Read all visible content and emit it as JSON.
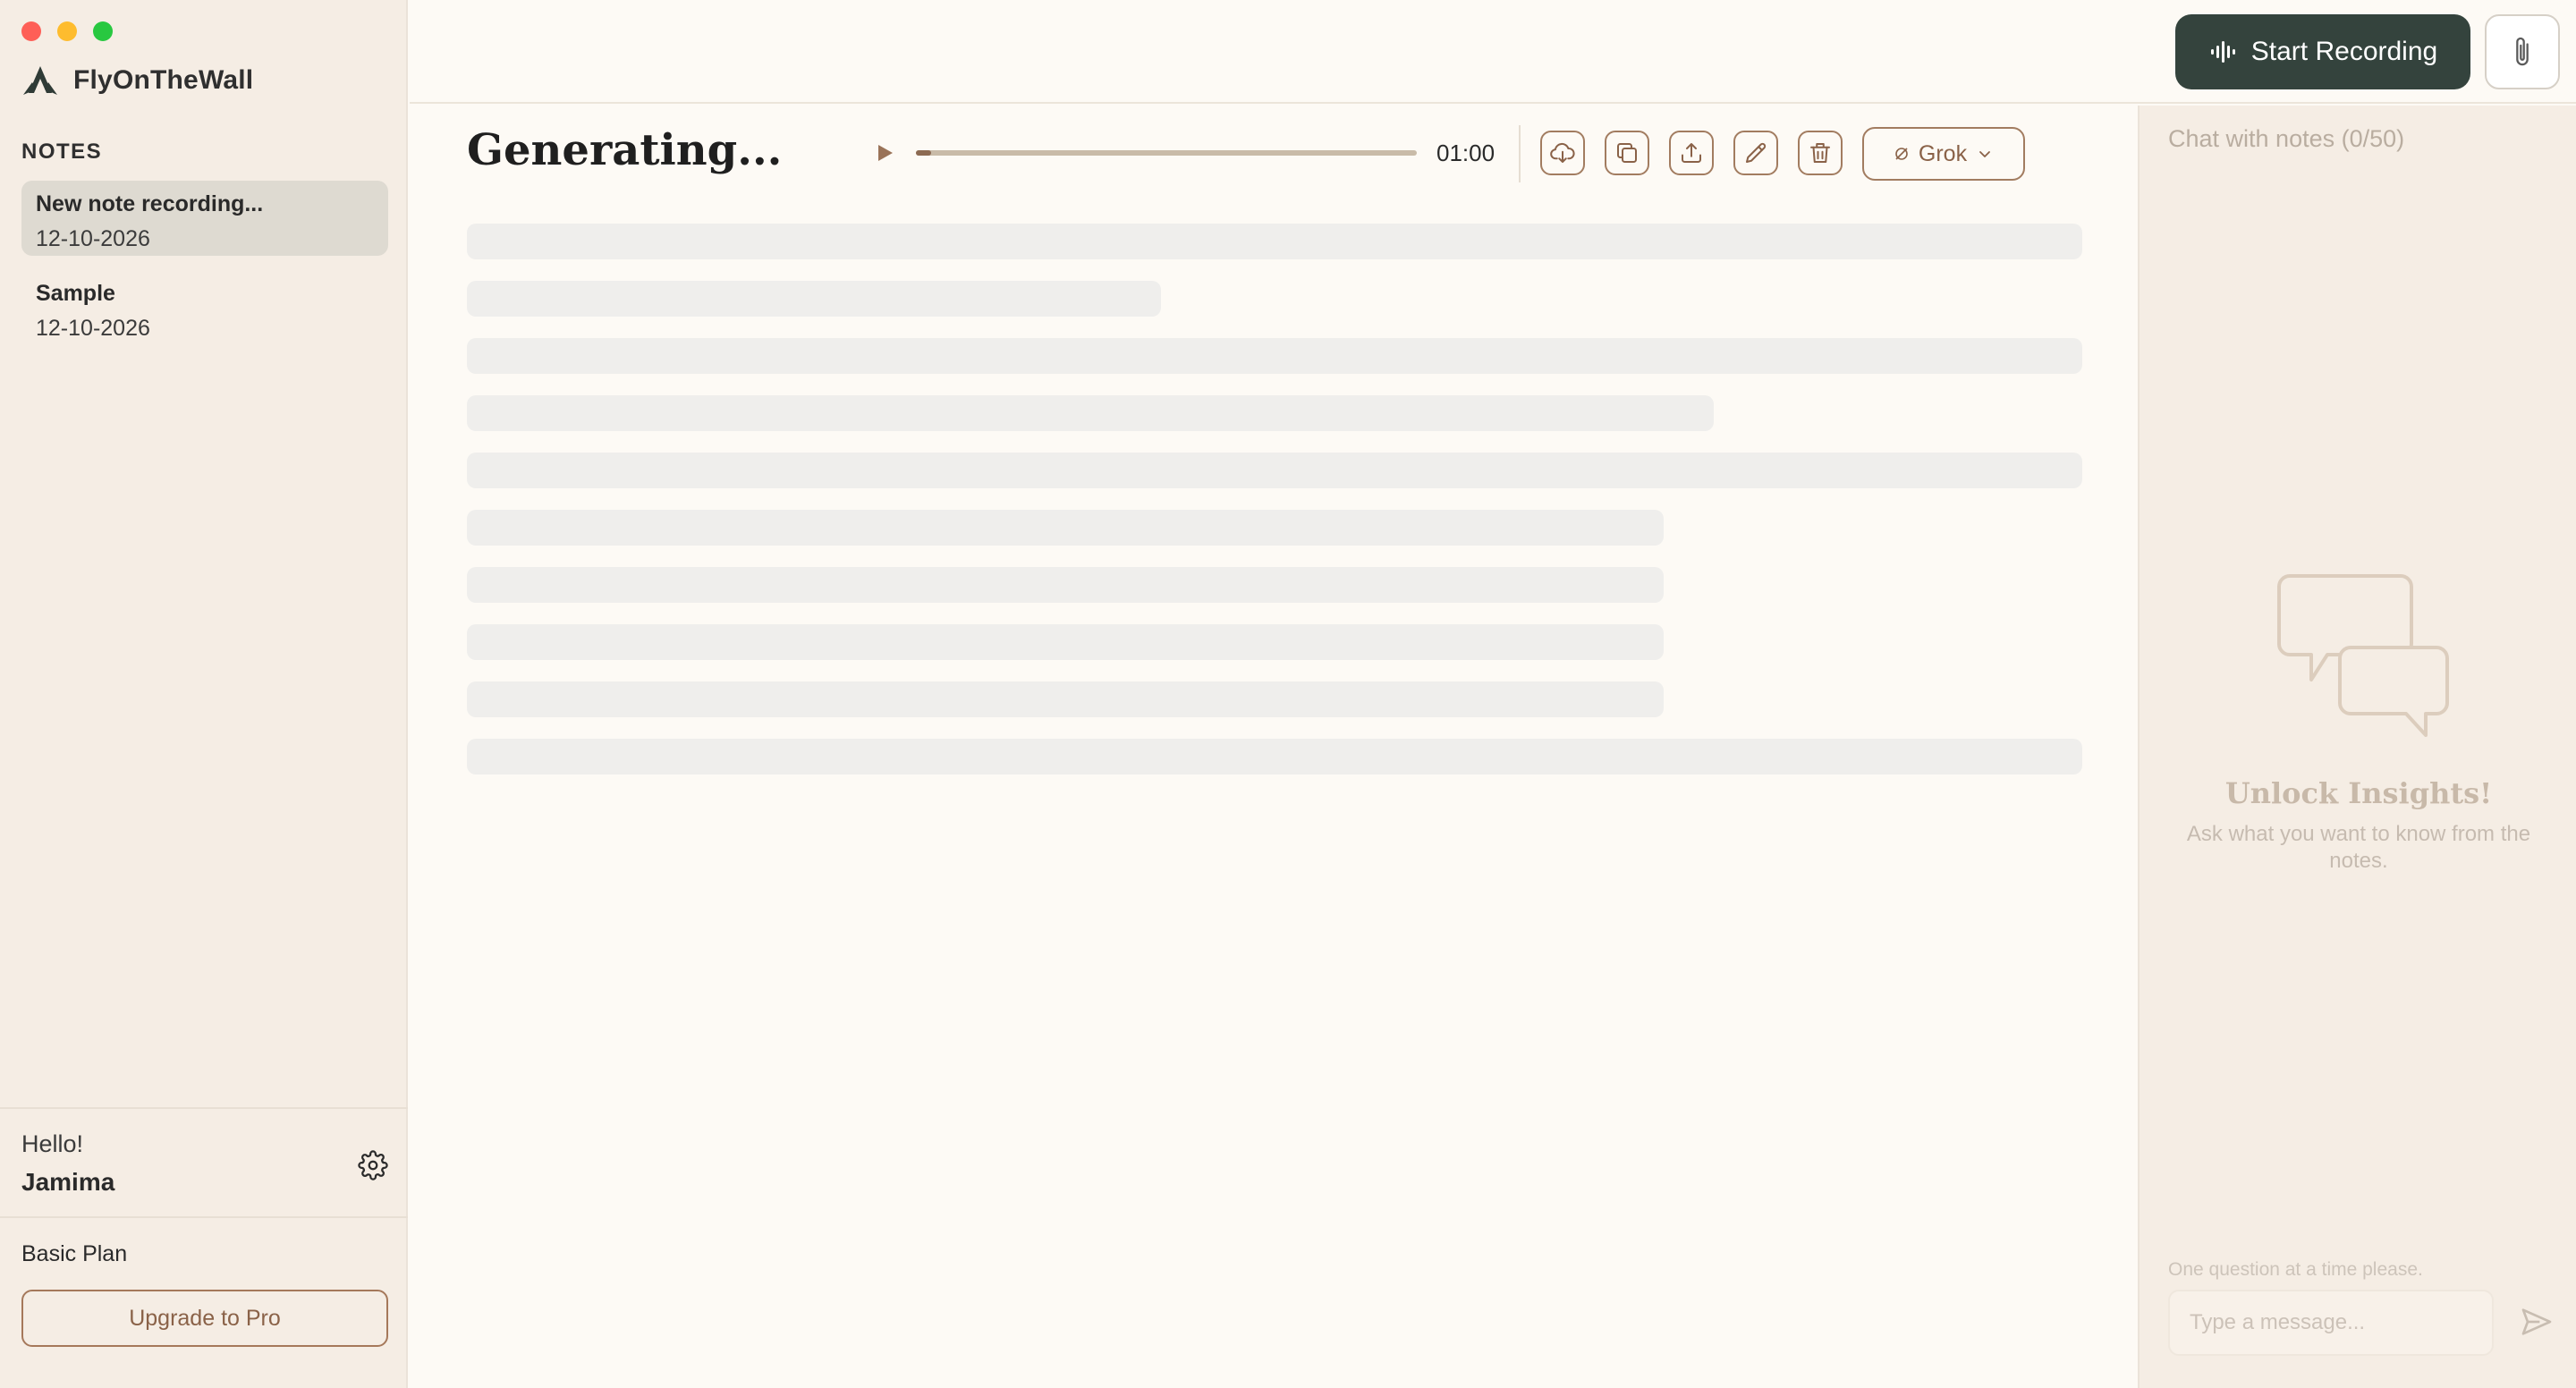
{
  "app": {
    "name": "FlyOnTheWall"
  },
  "sidebar": {
    "notes_heading": "NOTES",
    "notes": [
      {
        "title": "New note recording...",
        "date": "12-10-2026",
        "active": true
      },
      {
        "title": "Sample",
        "date": "12-10-2026",
        "active": false
      }
    ],
    "greeting": "Hello!",
    "user_name": "Jamima",
    "plan": "Basic Plan",
    "upgrade_label": "Upgrade to Pro"
  },
  "header": {
    "record_label": "Start Recording"
  },
  "note_view": {
    "title": "Generating...",
    "duration": "01:00",
    "progress_fraction": 0.03,
    "model": "Grok",
    "tools": [
      "download-icon",
      "copy-icon",
      "export-icon",
      "edit-icon",
      "delete-icon"
    ],
    "loading_lines": 10
  },
  "chat": {
    "title": "Chat with notes",
    "count": "(0/50)",
    "empty_title": "Unlock Insights!",
    "empty_subtitle": "Ask what you want to know from the notes.",
    "hint": "One question at a time please.",
    "input_placeholder": "Type a message..."
  },
  "colors": {
    "sidebar_bg": "#f5ede4",
    "main_bg": "#fdfaf5",
    "accent": "#a27c60",
    "record_button": "#34433d"
  }
}
